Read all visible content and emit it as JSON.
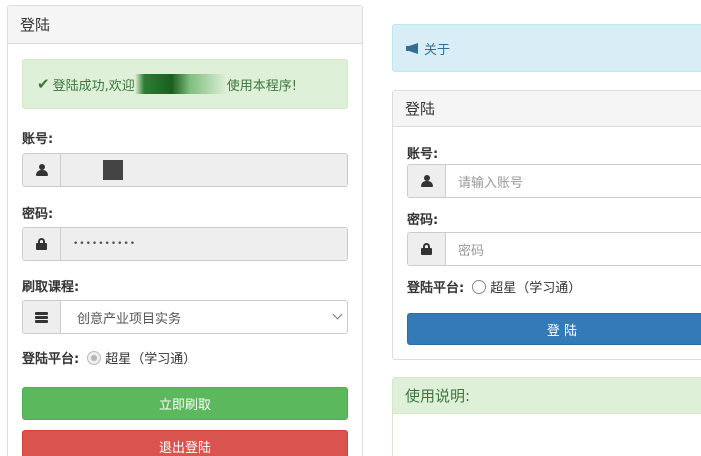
{
  "login_panel": {
    "title": "登陆",
    "success_prefix": "登陆成功,欢迎",
    "success_suffix": "使用本程序!",
    "account_label": "账号:",
    "account_value": "",
    "password_label": "密码:",
    "password_value": "••••••••••",
    "course_label": "刷取课程:",
    "course_selected": "创意产业项目实务",
    "platform_label": "登陆平台:",
    "platform_option": "超星（学习通）",
    "brush_button": "立即刷取",
    "logout_button": "退出登陆"
  },
  "about": {
    "label": "关于",
    "icon": "bullhorn-icon"
  },
  "login_form": {
    "title": "登陆",
    "account_label": "账号:",
    "account_placeholder": "请输入账号",
    "password_label": "密码:",
    "password_placeholder": "密码",
    "platform_label": "登陆平台:",
    "platform_option": "超星（学习通）",
    "login_button": "登 陆"
  },
  "usage": {
    "title": "使用说明:"
  },
  "colors": {
    "success_bg": "#dff0d8",
    "info_bg": "#d9edf7",
    "btn_green": "#5cb85c",
    "btn_red": "#d9534f",
    "btn_blue": "#337ab7"
  }
}
